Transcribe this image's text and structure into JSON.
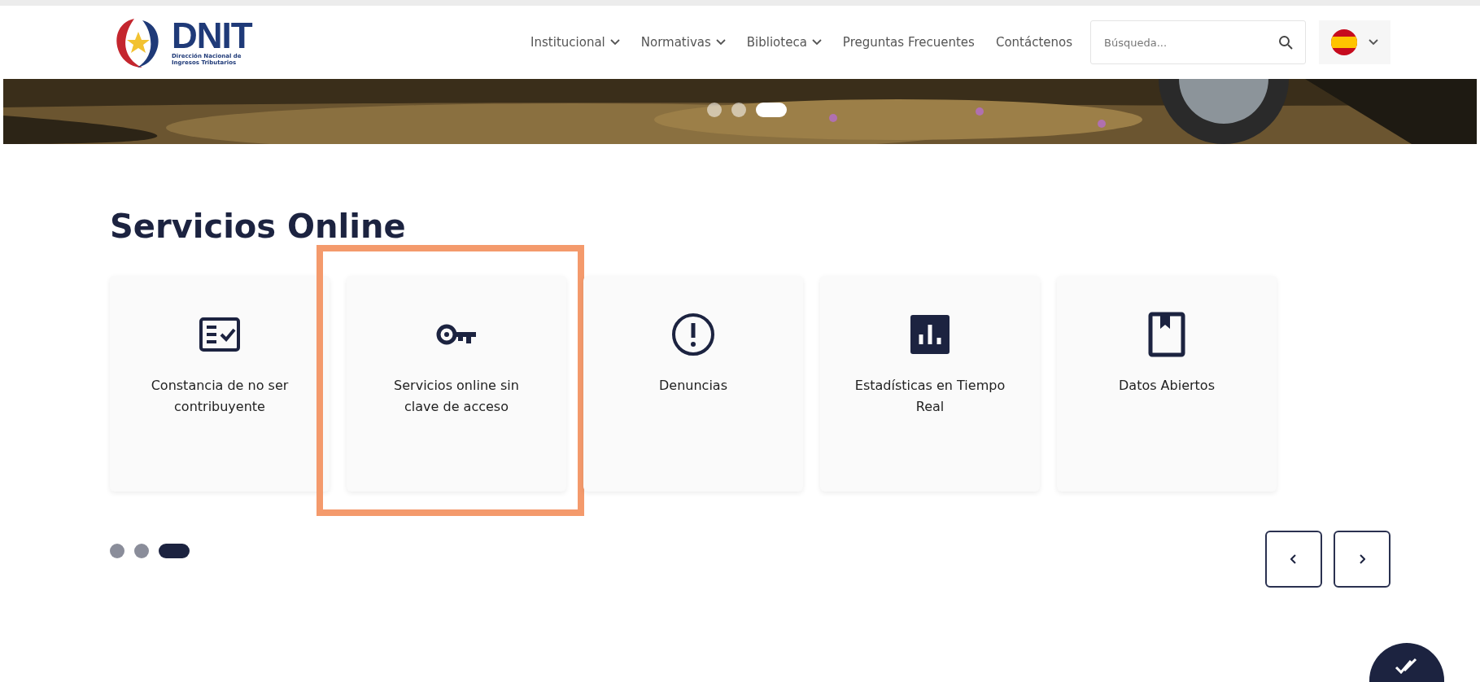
{
  "header": {
    "logo": {
      "name": "DNIT",
      "subtitle": "Dirección Nacional de Ingresos Tributarios"
    },
    "nav": [
      {
        "label": "Institucional",
        "dropdown": true
      },
      {
        "label": "Normativas",
        "dropdown": true
      },
      {
        "label": "Biblioteca",
        "dropdown": true
      },
      {
        "label": "Preguntas Frecuentes",
        "dropdown": false
      },
      {
        "label": "Contáctenos",
        "dropdown": false
      }
    ],
    "search": {
      "placeholder": "Búsqueda..."
    }
  },
  "banner": {
    "kind": "picture",
    "dots": [
      {
        "selected": false
      },
      {
        "selected": false
      },
      {
        "selected": true
      }
    ]
  },
  "services": {
    "title": "Servicios Online",
    "cards": [
      {
        "kind": "checklist",
        "label": "Constancia de no ser contribuyente",
        "highlighted": false
      },
      {
        "kind": "key",
        "label": "Servicios online sin clave de acceso",
        "highlighted": true
      },
      {
        "kind": "alert",
        "label": "Denuncias",
        "highlighted": false
      },
      {
        "kind": "chart",
        "label": "Estadísticas en Tiempo Real",
        "highlighted": false
      },
      {
        "kind": "book",
        "label": "Datos Abiertos",
        "highlighted": false
      }
    ],
    "dots": [
      {
        "selected": false
      },
      {
        "selected": false
      },
      {
        "selected": true
      }
    ]
  }
}
